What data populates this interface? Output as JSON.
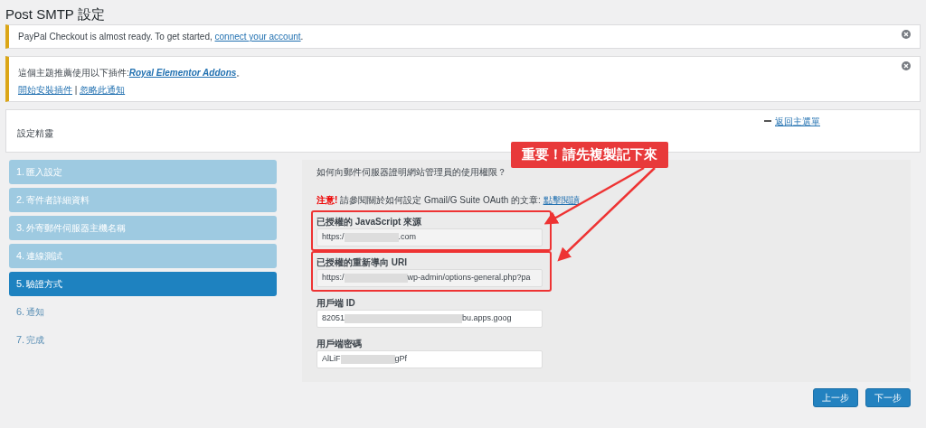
{
  "page_title": "Post SMTP 設定",
  "notices": [
    {
      "text_before": "PayPal Checkout is almost ready. To get started, ",
      "link": "connect your account",
      "link_emphasis": false,
      "text_after": "."
    },
    {
      "text_before": "這個主題推薦使用以下插件:",
      "link": "Royal Elementor Addons",
      "link_emphasis": true,
      "text_after": "。",
      "actions": [
        "開始安裝插件",
        "忽略此通知"
      ],
      "separator": "|"
    }
  ],
  "wizard": {
    "title": "設定精靈",
    "back_link": "返回主選單"
  },
  "steps": [
    {
      "number": "1.",
      "label": "匯入設定",
      "done": true,
      "selected": false
    },
    {
      "number": "2.",
      "label": "寄件者詳細資料",
      "done": true,
      "selected": false
    },
    {
      "number": "3.",
      "label": "外寄郵件伺服器主機名稱",
      "done": true,
      "selected": false
    },
    {
      "number": "4.",
      "label": "連線測試",
      "done": true,
      "selected": false
    },
    {
      "number": "5.",
      "label": "驗證方式",
      "done": false,
      "selected": true
    },
    {
      "number": "6.",
      "label": "通知",
      "done": false,
      "selected": false
    },
    {
      "number": "7.",
      "label": "完成",
      "done": false,
      "selected": false
    }
  ],
  "panel": {
    "question": "如何向郵件伺服器證明網站管理員的使用權限？",
    "note_label": "注意!",
    "note_text": " 請參閱關於如何設定 Gmail/G Suite OAuth 的文章: ",
    "note_link": "點擊閱讀",
    "fields": [
      {
        "label": "已授權的 JavaScript 來源",
        "value_start": "https:/",
        "value_end": ".com",
        "readonly": true,
        "highlighted": true
      },
      {
        "label": "已授權的重新導向 URI",
        "value_start": "https:/",
        "value_end": "wp-admin/options-general.php?pa",
        "readonly": true,
        "highlighted": true
      },
      {
        "label": "用戶端 ID",
        "value_start": "82051",
        "value_end": "bu.apps.goog",
        "readonly": false,
        "highlighted": false
      },
      {
        "label": "用戶端密碼",
        "value_start": "AlLiF",
        "value_end": "gPf",
        "readonly": false,
        "highlighted": false
      }
    ]
  },
  "buttons": [
    "上一步",
    "下一步"
  ],
  "callout": "重要！請先複製記下來"
}
